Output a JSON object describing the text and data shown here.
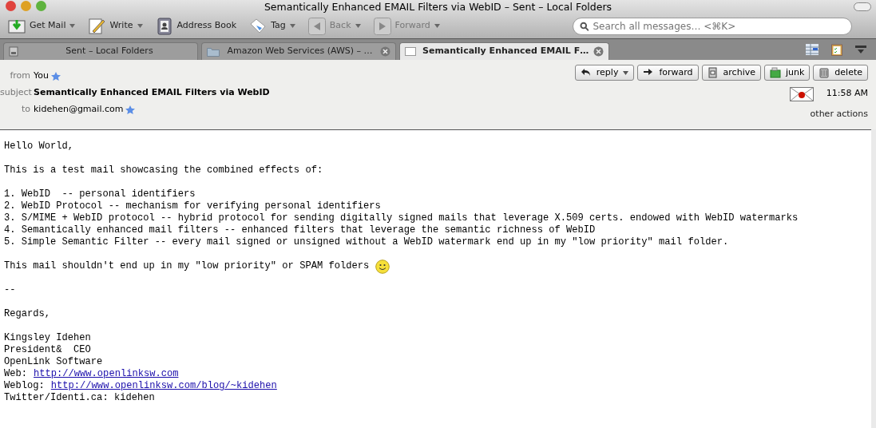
{
  "window": {
    "title": "Semantically Enhanced EMAIL Filters via WebID – Sent – Local Folders"
  },
  "toolbar": [
    {
      "kind": "getmail",
      "label": "Get Mail",
      "dropdown": true,
      "disabled": false
    },
    {
      "kind": "write",
      "label": "Write",
      "dropdown": true,
      "disabled": false
    },
    {
      "kind": "addressbook",
      "label": "Address Book",
      "dropdown": false,
      "disabled": false
    },
    {
      "kind": "tag",
      "label": "Tag",
      "dropdown": true,
      "disabled": false
    },
    {
      "kind": "back",
      "label": "Back",
      "dropdown": true,
      "disabled": true
    },
    {
      "kind": "forward",
      "label": "Forward",
      "dropdown": true,
      "disabled": true
    }
  ],
  "search": {
    "placeholder": "Search all messages… <⌘K>"
  },
  "tabs": [
    {
      "kind": "mailbox",
      "label": "Sent – Local Folders",
      "selected": false,
      "closable": false
    },
    {
      "kind": "folder",
      "label": "Amazon Web Services (AWS) – …",
      "selected": false,
      "closable": true
    },
    {
      "kind": "message",
      "label": "Semantically Enhanced EMAIL F…",
      "selected": true,
      "closable": true
    }
  ],
  "header": {
    "fields": [
      {
        "label": "from",
        "value": "You",
        "starred": true,
        "bold": false
      },
      {
        "label": "subject",
        "value": "Semantically Enhanced EMAIL Filters via WebID",
        "starred": false,
        "bold": true
      },
      {
        "label": "to",
        "value": "kidehen@gmail.com",
        "starred": true,
        "bold": false
      }
    ],
    "actions": [
      {
        "kind": "reply",
        "label": "reply",
        "dropdown": true
      },
      {
        "kind": "forward",
        "label": "forward",
        "dropdown": false
      },
      {
        "kind": "archive",
        "label": "archive",
        "dropdown": false
      },
      {
        "kind": "junk",
        "label": "junk",
        "dropdown": false
      },
      {
        "kind": "delete",
        "label": "delete",
        "dropdown": false
      }
    ],
    "time": "11:58 AM",
    "other_actions": "other actions"
  },
  "body": [
    {
      "kind": "text",
      "text": "Hello World,"
    },
    {
      "kind": "blank"
    },
    {
      "kind": "text",
      "text": "This is a test mail showcasing the combined effects of:"
    },
    {
      "kind": "blank"
    },
    {
      "kind": "text",
      "text": "1. WebID  -- personal identifiers"
    },
    {
      "kind": "text",
      "text": "2. WebID Protocol -- mechanism for verifying personal identifiers"
    },
    {
      "kind": "text",
      "text": "3. S/MIME + WebID protocol -- hybrid protocol for sending digitally signed mails that leverage X.509 certs. endowed with WebID watermarks"
    },
    {
      "kind": "text",
      "text": "4. Semantically enhanced mail filters -- enhanced filters that leverage the semantic richness of WebID"
    },
    {
      "kind": "text",
      "text": "5. Simple Semantic Filter -- every mail signed or unsigned without a WebID watermark end up in my \"low priority\" mail folder."
    },
    {
      "kind": "blank"
    },
    {
      "kind": "smiley",
      "text": "This mail shouldn't end up in my \"low priority\" or SPAM folders"
    },
    {
      "kind": "blank"
    },
    {
      "kind": "text",
      "text": "--"
    },
    {
      "kind": "blank"
    },
    {
      "kind": "text",
      "text": "Regards,"
    },
    {
      "kind": "blank"
    },
    {
      "kind": "text",
      "text": "Kingsley Idehen"
    },
    {
      "kind": "text",
      "text": "President&  CEO"
    },
    {
      "kind": "text",
      "text": "OpenLink Software"
    },
    {
      "kind": "link",
      "text": "Web:",
      "link": "http://www.openlinksw.com"
    },
    {
      "kind": "link",
      "text": "Weblog:",
      "link": "http://www.openlinksw.com/blog/~kidehen"
    },
    {
      "kind": "text",
      "text": "Twitter/Identi.ca: kidehen"
    }
  ]
}
